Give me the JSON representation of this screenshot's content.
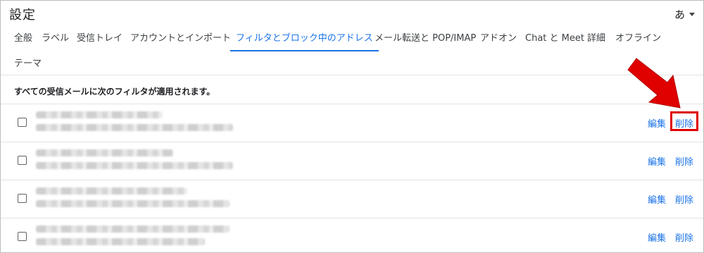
{
  "header": {
    "title": "設定",
    "language_label": "あ"
  },
  "tabs": [
    {
      "label": "全般"
    },
    {
      "label": "ラベル"
    },
    {
      "label": "受信トレイ"
    },
    {
      "label": "アカウントとインポート"
    },
    {
      "label": "フィルタとブロック中のアドレス",
      "active": true
    },
    {
      "label": "メール転送と POP/IMAP"
    },
    {
      "label": "アドオン"
    },
    {
      "label": "Chat と Meet"
    },
    {
      "label": "詳細"
    },
    {
      "label": "オフライン"
    },
    {
      "label": "テーマ"
    }
  ],
  "filters": {
    "heading": "すべての受信メールに次のフィルタが適用されます。",
    "edit_label": "編集",
    "delete_label": "削除",
    "row_count": 4
  },
  "annotation": {
    "color": "#e00000"
  },
  "accent_color": "#1a73e8"
}
